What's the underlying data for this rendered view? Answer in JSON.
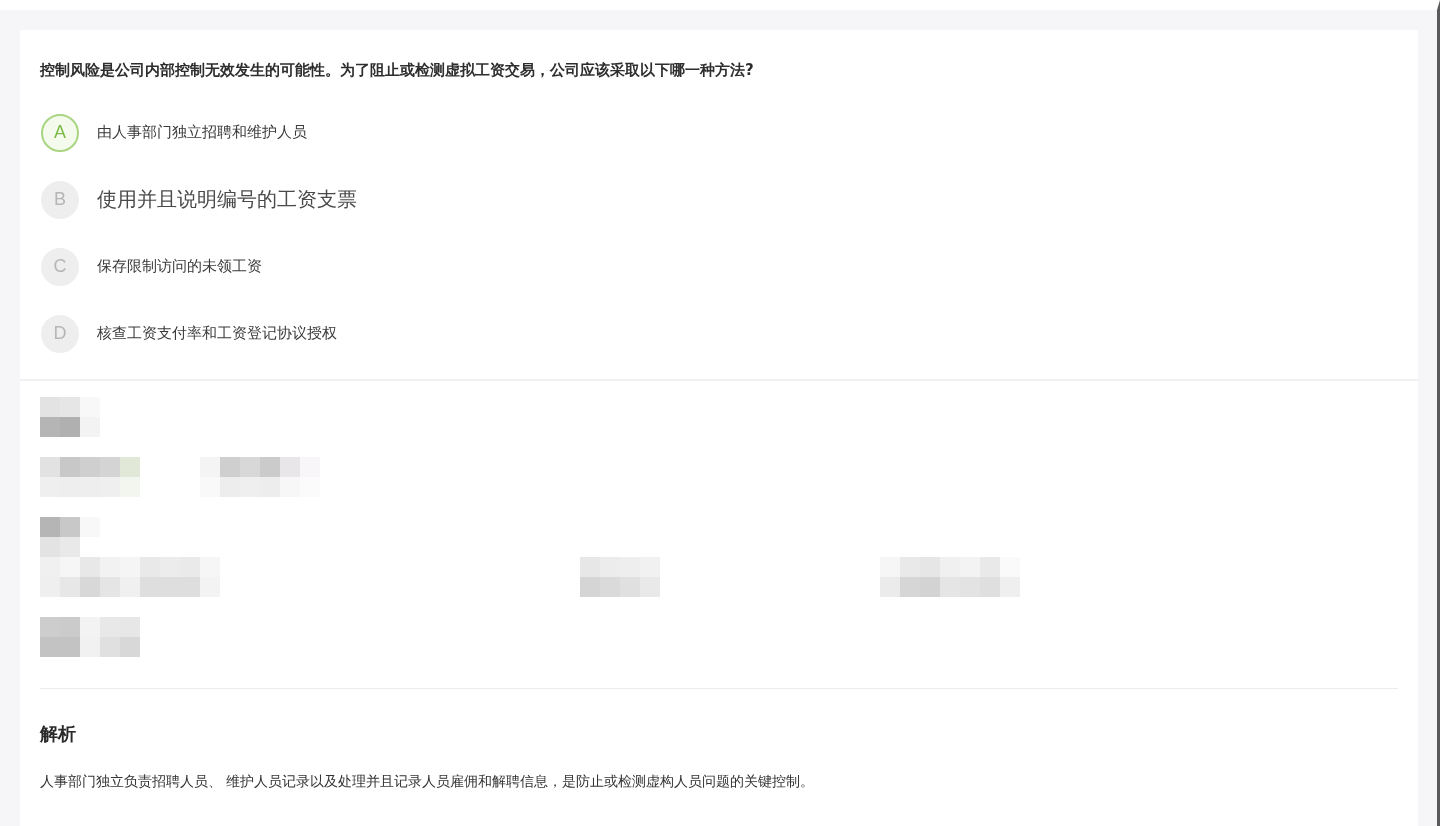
{
  "question": {
    "text": "控制风险是公司内部控制无效发生的可能性。为了阻止或检测虚拟工资交易，公司应该采取以下哪一种方法?"
  },
  "options": [
    {
      "letter": "A",
      "text": "由人事部门独立招聘和维护人员",
      "selected": true,
      "kind": "normal"
    },
    {
      "letter": "B",
      "text": "使用并且说明编号的工资支票",
      "selected": false,
      "kind": "large"
    },
    {
      "letter": "C",
      "text": "保存限制访问的未领工资",
      "selected": false,
      "kind": "normal"
    },
    {
      "letter": "D",
      "text": "核查工资支付率和工资登记协议授权",
      "selected": false,
      "kind": "normal"
    }
  ],
  "analysis": {
    "title": "解析",
    "text": "人事部门独立负责招聘人员、 维护人员记录以及处理并且记录人员雇佣和解聘信息，是防止或检测虚构人员问题的关键控制。"
  }
}
